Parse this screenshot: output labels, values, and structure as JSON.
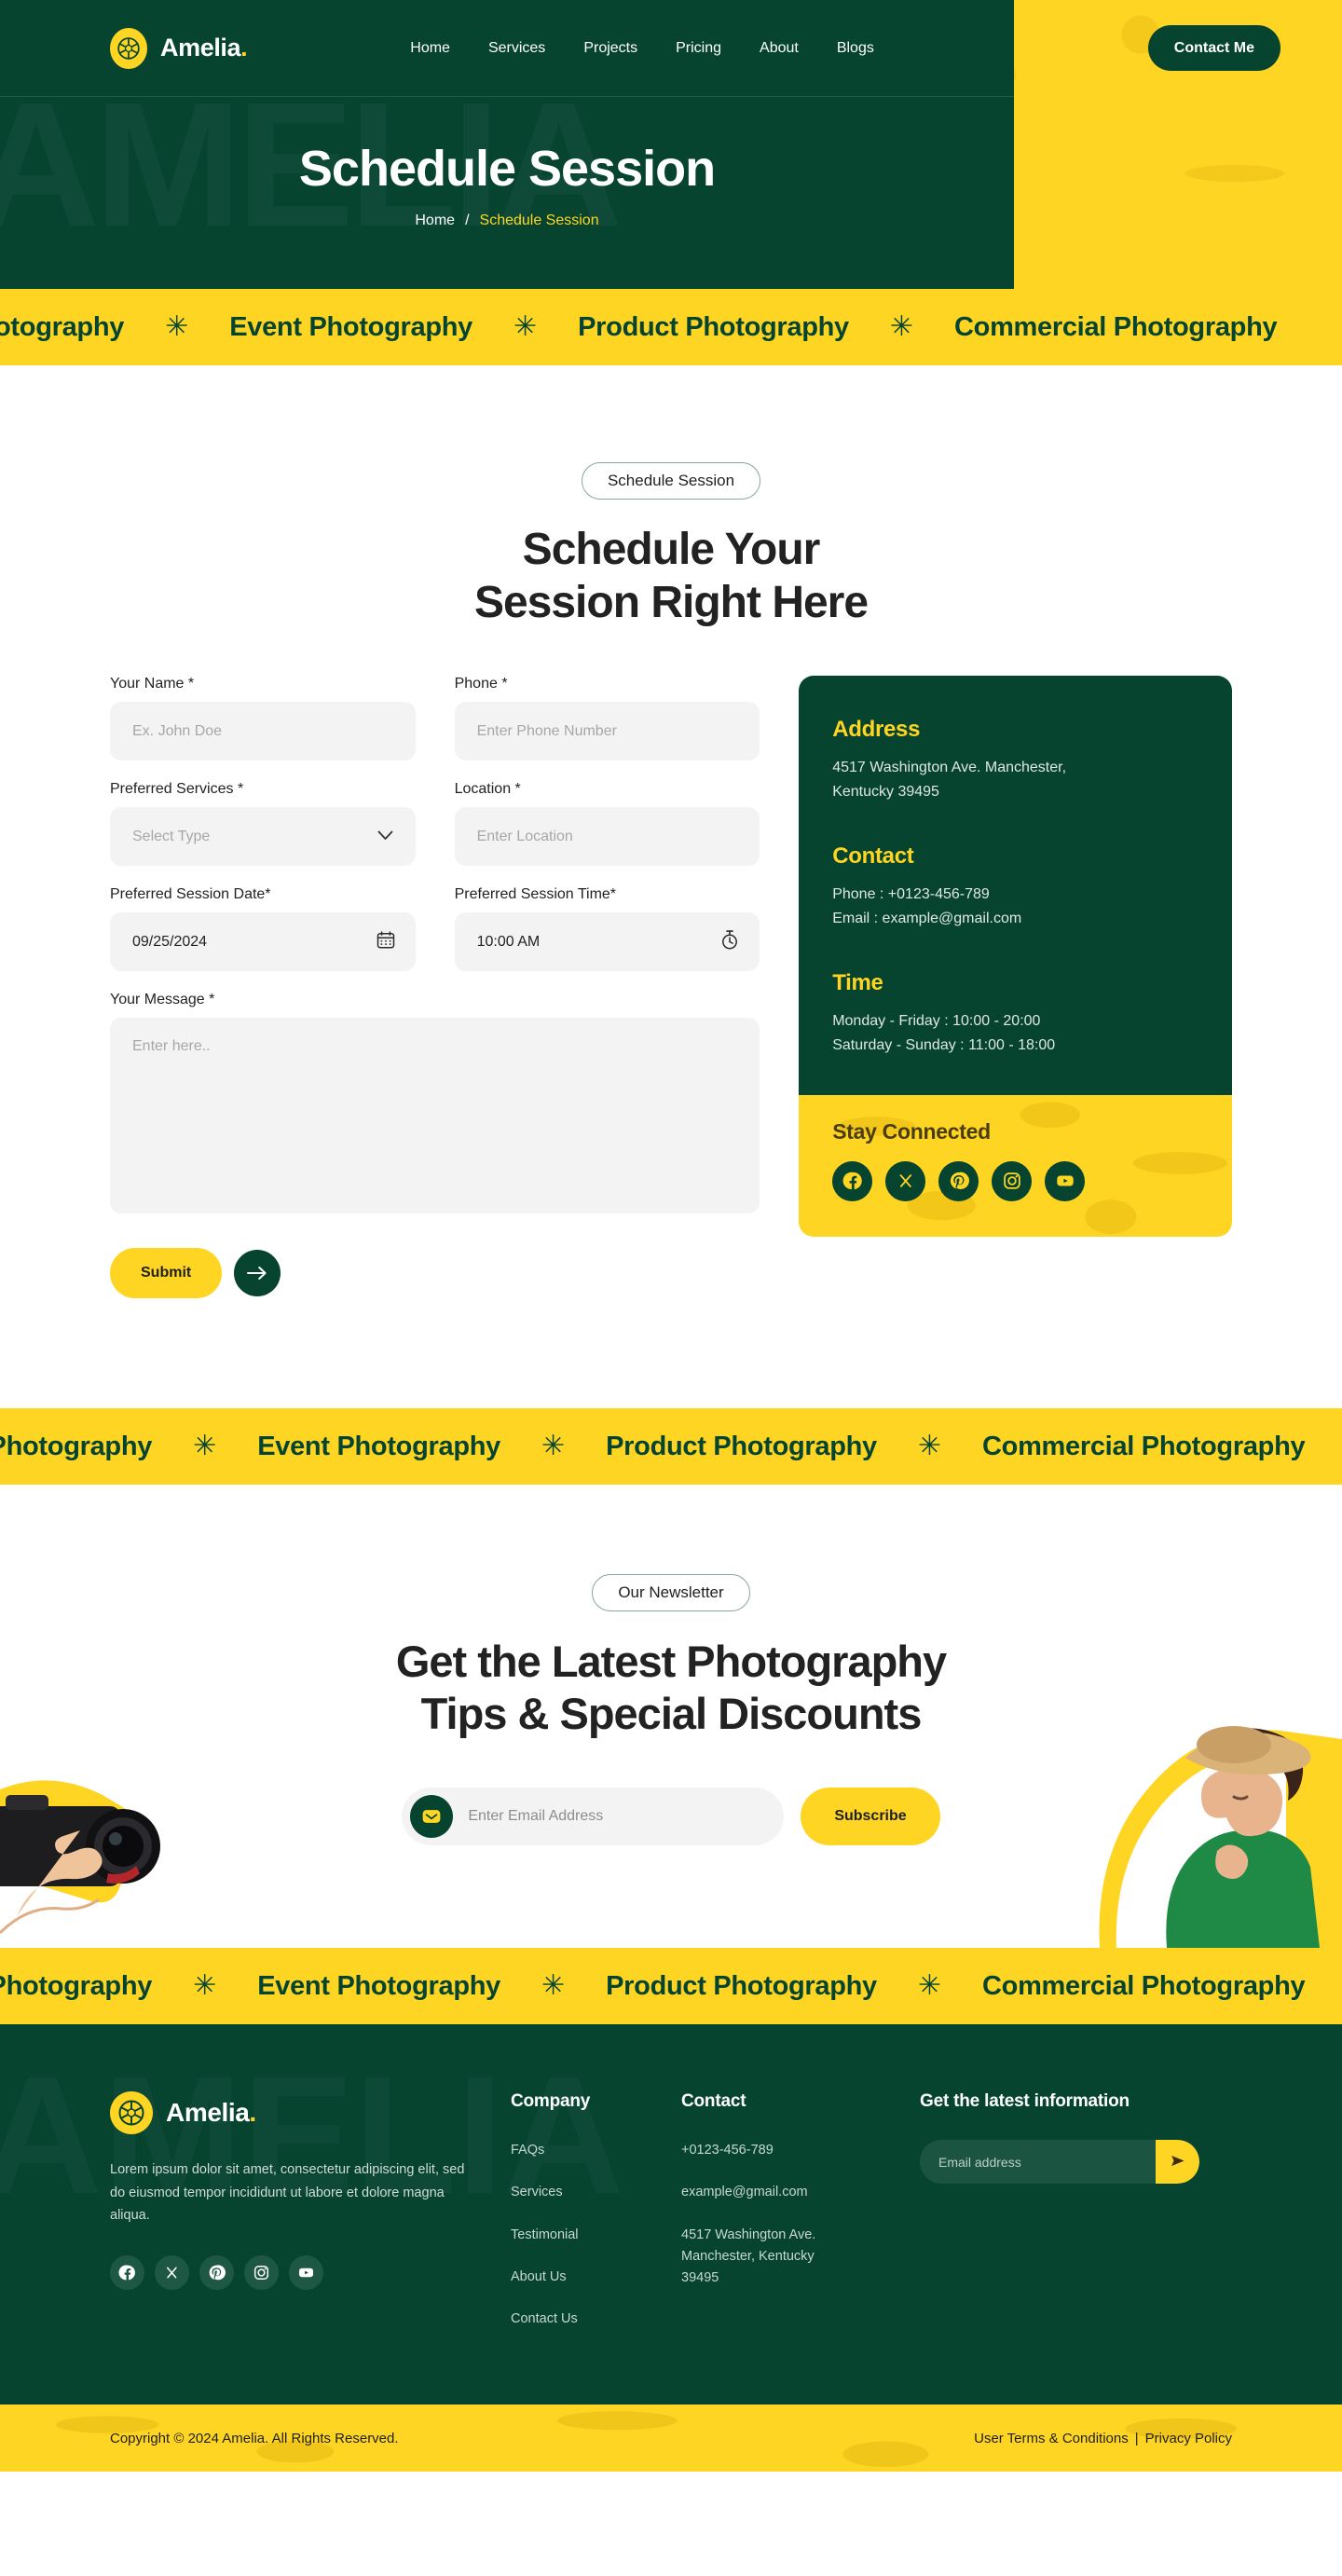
{
  "brand": {
    "name": "Amelia",
    "dot": ".",
    "logo_icon": "camera-shutter-icon"
  },
  "nav": {
    "links": [
      "Home",
      "Services",
      "Projects",
      "Pricing",
      "About",
      "Blogs"
    ],
    "cta_label": "Contact Me"
  },
  "hero": {
    "ghost_text": "AMELIA",
    "title": "Schedule Session",
    "breadcrumb": {
      "home": "Home",
      "separator": "/",
      "current": "Schedule Session"
    }
  },
  "marquee": {
    "items": [
      "Wedding Photography",
      "Event Photography",
      "Product Photography",
      "Commercial Photography"
    ],
    "star_glyph": "✳"
  },
  "form_section": {
    "eyebrow": "Schedule Session",
    "title_line1": "Schedule Your",
    "title_line2": "Session Right Here",
    "fields": {
      "name": {
        "label": "Your Name *",
        "placeholder": "Ex. John Doe",
        "value": ""
      },
      "phone": {
        "label": "Phone *",
        "placeholder": "Enter Phone Number",
        "value": ""
      },
      "services": {
        "label": "Preferred Services *",
        "placeholder": "Select Type",
        "value": "",
        "icon": "chevron-down-icon"
      },
      "location": {
        "label": "Location *",
        "placeholder": "Enter Location",
        "value": ""
      },
      "date": {
        "label": "Preferred Session Date*",
        "value": "09/25/2024",
        "icon": "calendar-icon"
      },
      "time": {
        "label": "Preferred Session Time*",
        "value": "10:00 AM",
        "icon": "clock-icon"
      },
      "message": {
        "label": "Your Message *",
        "placeholder": "Enter here..",
        "value": ""
      }
    },
    "submit_label": "Submit",
    "submit_arrow_icon": "arrow-right-icon"
  },
  "info_card": {
    "address": {
      "heading": "Address",
      "line1": "4517 Washington Ave. Manchester,",
      "line2": "Kentucky 39495"
    },
    "contact": {
      "heading": "Contact",
      "phone": "Phone : +0123-456-789",
      "email": "Email  : example@gmail.com"
    },
    "time": {
      "heading": "Time",
      "weekday": "Monday - Friday    : 10:00 - 20:00",
      "weekend": "Saturday - Sunday : 11:00 - 18:00"
    },
    "stay_connected": {
      "heading": "Stay Connected",
      "socials": [
        "facebook-icon",
        "x-twitter-icon",
        "pinterest-icon",
        "instagram-icon",
        "youtube-icon"
      ]
    }
  },
  "newsletter": {
    "eyebrow": "Our Newsletter",
    "title_line1": "Get the Latest Photography",
    "title_line2": "Tips & Special Discounts",
    "email_placeholder": "Enter Email Address",
    "email_value": "",
    "mail_icon": "envelope-icon",
    "subscribe_label": "Subscribe"
  },
  "footer": {
    "ghost_text": "AMELIA",
    "description": "Lorem ipsum dolor sit amet, consectetur adipiscing elit, sed do eiusmod tempor incididunt ut labore et dolore magna aliqua.",
    "socials": [
      "facebook-icon",
      "x-twitter-icon",
      "pinterest-icon",
      "instagram-icon",
      "youtube-icon"
    ],
    "company": {
      "heading": "Company",
      "links": [
        "FAQs",
        "Services",
        "Testimonial",
        "About Us",
        "Contact Us"
      ]
    },
    "contact": {
      "heading": "Contact",
      "phone": "+0123-456-789",
      "email": "example@gmail.com",
      "address": "4517 Washington Ave. Manchester, Kentucky 39495"
    },
    "news": {
      "heading": "Get the latest information",
      "placeholder": "Email address",
      "value": "",
      "send_icon": "send-icon"
    },
    "copyright": "Copyright © 2024 Amelia. All Rights Reserved.",
    "terms": "User Terms & Conditions",
    "terms_sep": "|",
    "privacy": "Privacy Policy"
  },
  "colors": {
    "green": "#064430",
    "yellow": "#ffd524",
    "dark_text": "#1f1f1f",
    "field_bg": "#f3f3f3"
  }
}
